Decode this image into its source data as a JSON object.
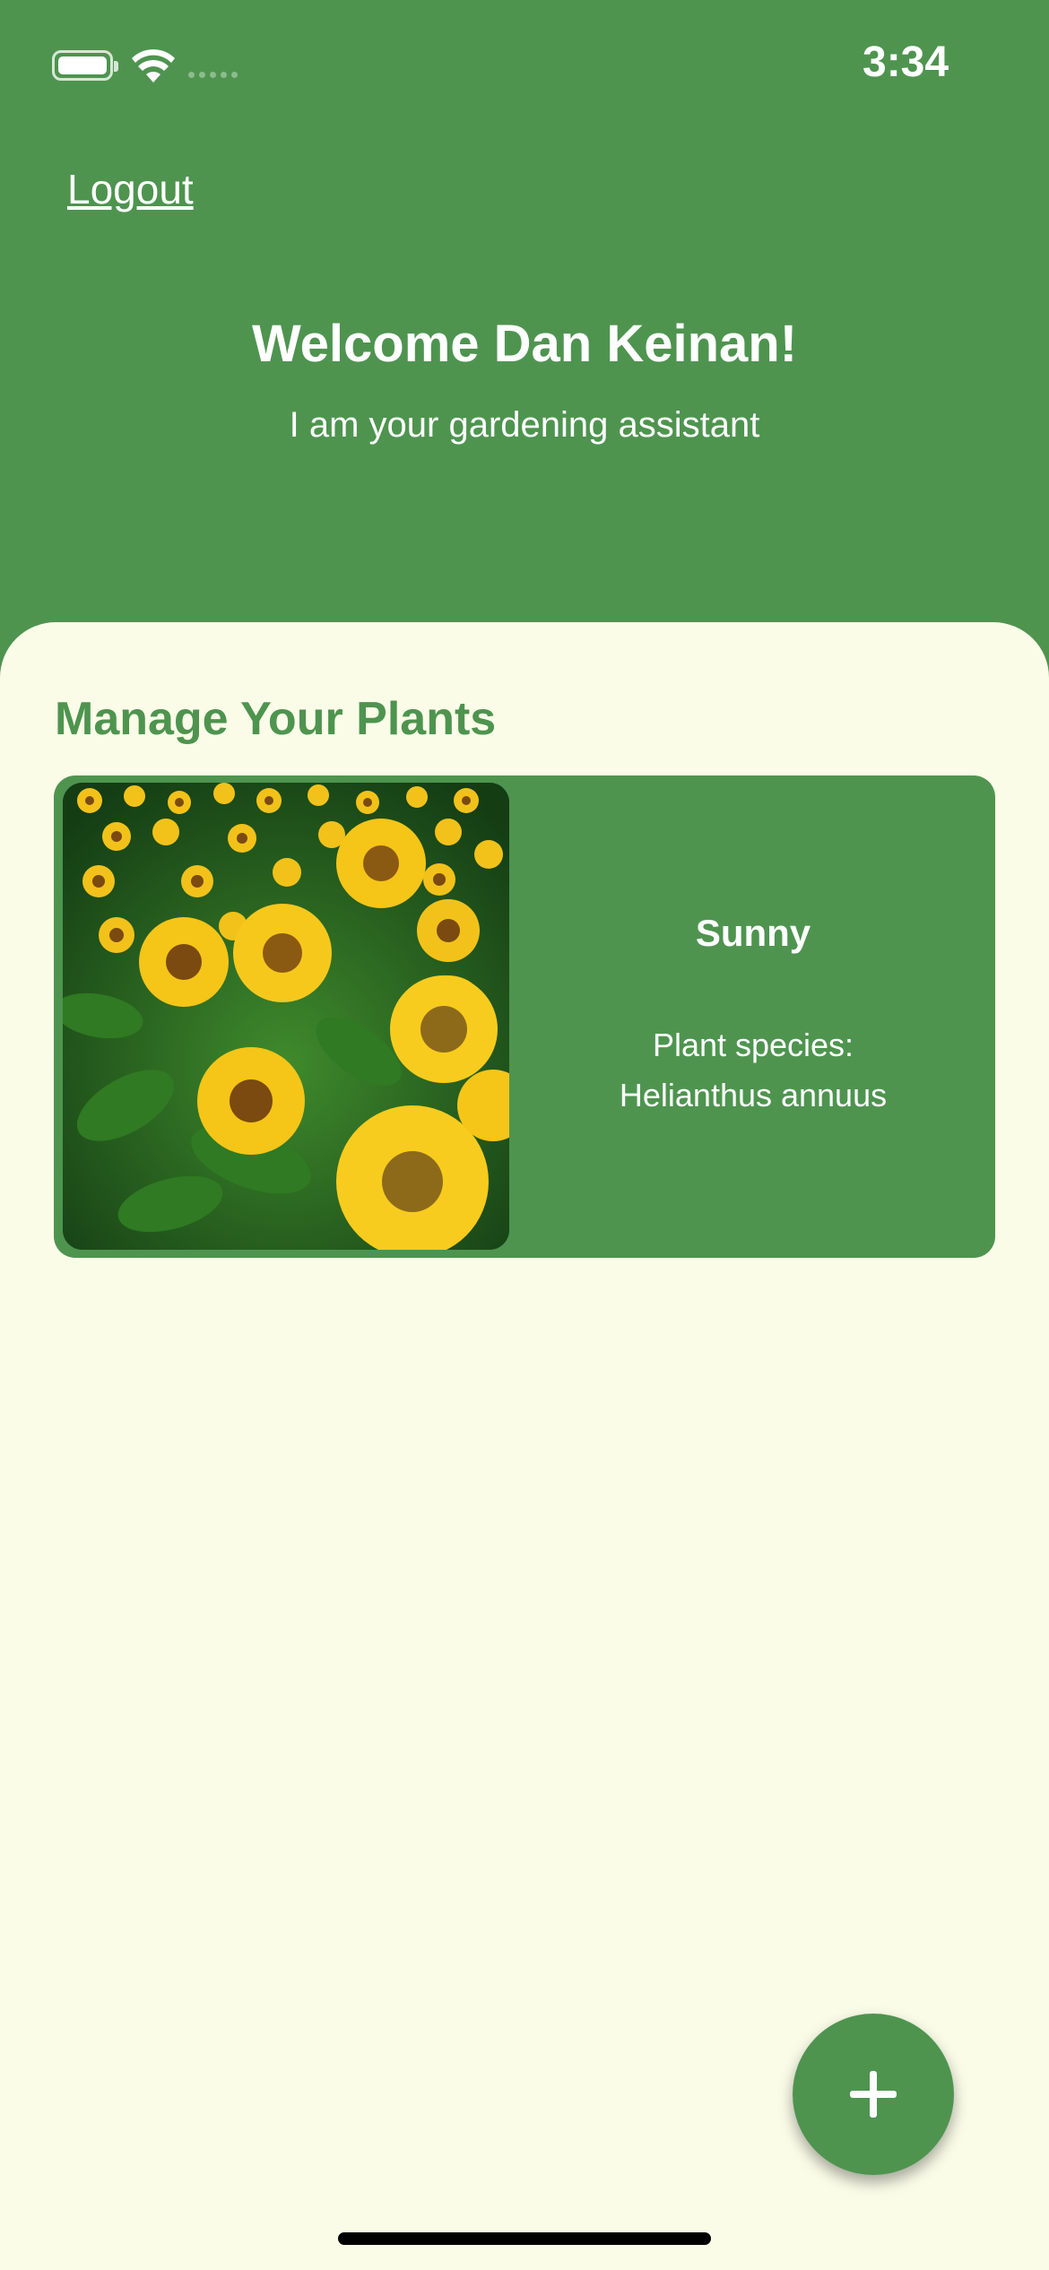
{
  "status_bar": {
    "time": "3:34"
  },
  "header": {
    "logout_label": "Logout",
    "welcome": "Welcome Dan Keinan!",
    "subtitle": "I am your gardening assistant"
  },
  "main": {
    "section_title": "Manage Your Plants",
    "plants": [
      {
        "name": "Sunny",
        "species_label": "Plant species:",
        "species": "Helianthus annuus"
      }
    ]
  },
  "colors": {
    "primary": "#4e944f",
    "background": "#fafce8",
    "text_on_primary": "#ffffff"
  },
  "icons": {
    "fab": "plus-icon",
    "status": [
      "battery-icon",
      "wifi-icon",
      "cellular-signal-icon"
    ]
  }
}
